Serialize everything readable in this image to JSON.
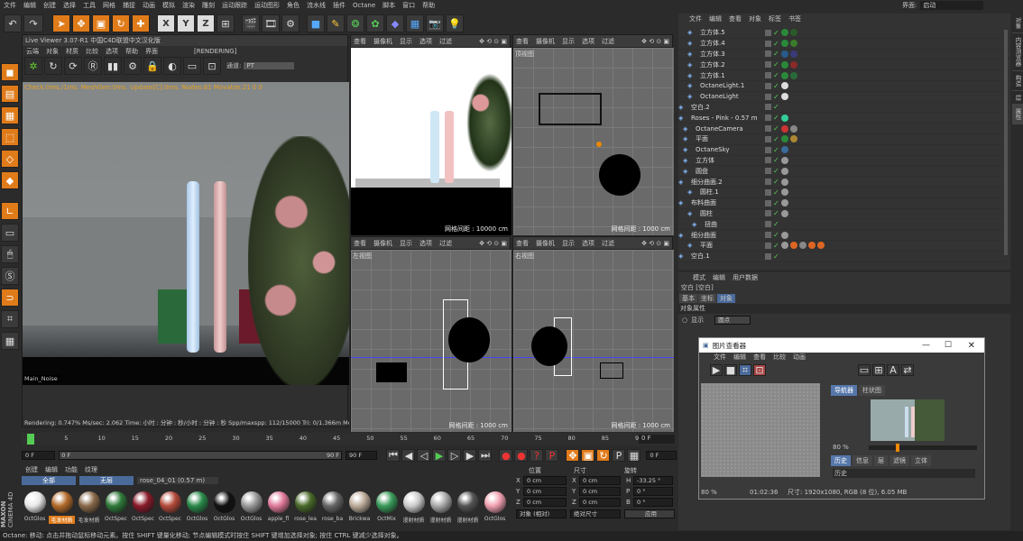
{
  "main_menu": [
    "文件",
    "编辑",
    "创建",
    "选择",
    "工具",
    "网格",
    "捕捉",
    "动画",
    "模拟",
    "渲染",
    "雕刻",
    "运动跟踪",
    "运动图形",
    "角色",
    "流水线",
    "插件",
    "Octane",
    "脚本",
    "窗口",
    "帮助"
  ],
  "layout": {
    "label": "界面:",
    "value": "启动"
  },
  "live_viewer": {
    "title": "Live Viewer 3.07-R1 中国C4D联盟中文汉化版",
    "menu": [
      "云端",
      "对象",
      "材质",
      "比较",
      "选项",
      "帮助",
      "界面"
    ],
    "status_tag": "[RENDERING]",
    "channel_label": "通道:",
    "channel_value": "PT",
    "check_line": "Check:0ms./1ms. MeshGen:0ms. Update[C]:0ms. Nodes:81 Movable:21 0 0",
    "noise_label": "Main_Noise",
    "bottom_status": "Rendering: 0.747% Ms/sec: 2.062    Time: 小时 : 分钟 : 秒/小时 : 分钟 : 秒    Spp/maxspp: 112/15000  Tri: 0/1.366m  Mesh: 23  Hai"
  },
  "viewport_menu": [
    "查看",
    "摄像机",
    "显示",
    "选项",
    "过滤"
  ],
  "viewports": [
    {
      "name": "",
      "grid": ""
    },
    {
      "name": "顶视图",
      "grid": "网格间距 : 1000 cm"
    },
    {
      "name": "左视图",
      "grid": "网格间距 : 1000 cm"
    },
    {
      "name": "右视图",
      "grid": "网格间距 : 1000 cm"
    }
  ],
  "camera_view_grid": "网格间距 : 10000 cm",
  "timeline": {
    "ticks": [
      "0",
      "5",
      "10",
      "15",
      "20",
      "25",
      "30",
      "35",
      "40",
      "45",
      "50",
      "55",
      "60",
      "65",
      "70",
      "75",
      "80",
      "85",
      "90"
    ],
    "current": "0 F",
    "start": "0 F",
    "range_start": "0 F",
    "range_end": "90 F",
    "end": "90 F",
    "end2": "0 F"
  },
  "material_manager": {
    "menu": [
      "创建",
      "编辑",
      "功能",
      "纹理"
    ],
    "filters": [
      "全部",
      "无层",
      "rose_04_01 (0.57 m)"
    ],
    "materials": [
      {
        "name": "OctGlos",
        "color": "#e8e8e8"
      },
      {
        "name": "毛发材质",
        "color": "#b36b2a",
        "selected": true
      },
      {
        "name": "毛发材质",
        "color": "#8a6a4a"
      },
      {
        "name": "OctSpec",
        "color": "#2f7a3a"
      },
      {
        "name": "OctSpec",
        "color": "#8a1a2a"
      },
      {
        "name": "OctSpec",
        "color": "#b34a3a"
      },
      {
        "name": "OctGlos",
        "color": "#2a8a4a"
      },
      {
        "name": "OctGlos",
        "color": "#111111"
      },
      {
        "name": "OctGlos",
        "color": "#999999"
      },
      {
        "name": "apple_fl",
        "color": "#e07a9a"
      },
      {
        "name": "rose_lea",
        "color": "#4a6a2a"
      },
      {
        "name": "rose_ba",
        "color": "#666666"
      },
      {
        "name": "Brickwa",
        "color": "#bbaa99"
      },
      {
        "name": "OctMix",
        "color": "#3a9a5a"
      },
      {
        "name": "漫射材质",
        "color": "#cccccc"
      },
      {
        "name": "漫射材质",
        "color": "#aaaaaa"
      },
      {
        "name": "漫射材质",
        "color": "#555555"
      },
      {
        "name": "OctGlos",
        "color": "#f0a0b0"
      }
    ]
  },
  "coords": {
    "headers": [
      "位置",
      "尺寸",
      "旋转"
    ],
    "rows": [
      {
        "axis": "X",
        "pos": "0 cm",
        "size": "0 cm",
        "rlabel": "H",
        "rot": "-33.25 °"
      },
      {
        "axis": "Y",
        "pos": "0 cm",
        "size": "0 cm",
        "rlabel": "P",
        "rot": "0 °"
      },
      {
        "axis": "Z",
        "pos": "0 cm",
        "size": "0 cm",
        "rlabel": "B",
        "rot": "0 °"
      }
    ],
    "mode": "对象 (相对)",
    "size_mode": "绝对尺寸",
    "apply": "应用"
  },
  "object_manager": {
    "menu": [
      "文件",
      "编辑",
      "查看",
      "对象",
      "标签",
      "书签"
    ],
    "objects": [
      {
        "name": "立方体.5",
        "indent": 2,
        "tags": [
          "#2a8a3a",
          "#2a5a2a"
        ]
      },
      {
        "name": "立方体.4",
        "indent": 2,
        "tags": [
          "#2a8a3a",
          "#3a7a2a"
        ]
      },
      {
        "name": "立方体.3",
        "indent": 2,
        "tags": [
          "#2a5a8a",
          "#3a3a7a"
        ]
      },
      {
        "name": "立方体.2",
        "indent": 2,
        "tags": [
          "#2a8a3a",
          "#8a2a2a"
        ]
      },
      {
        "name": "立方体.1",
        "indent": 2,
        "tags": [
          "#2a8a3a",
          "#2a6a3a"
        ]
      },
      {
        "name": "OctaneLight.1",
        "indent": 2,
        "tags": [
          "#dddddd"
        ]
      },
      {
        "name": "OctaneLight",
        "indent": 2,
        "tags": [
          "#dddddd"
        ]
      },
      {
        "name": "空白.2",
        "indent": 0,
        "tags": []
      },
      {
        "name": "Roses - Pink - 0.57 m",
        "indent": 0,
        "tags": [
          "#3c9"
        ]
      },
      {
        "name": "OctaneCamera",
        "indent": 1,
        "tags": [
          "#cc3333",
          "#888888"
        ]
      },
      {
        "name": "平面",
        "indent": 1,
        "tags": [
          "#2a8a3a",
          "#aa8833"
        ]
      },
      {
        "name": "OctaneSky",
        "indent": 1,
        "tags": [
          "#3a6a9a"
        ]
      },
      {
        "name": "立方体",
        "indent": 1,
        "tags": [
          "#999999"
        ]
      },
      {
        "name": "圆盘",
        "indent": 1,
        "tags": [
          "#999999"
        ]
      },
      {
        "name": "细分曲面.2",
        "indent": 0,
        "tags": [
          "#999999"
        ]
      },
      {
        "name": "圆柱.1",
        "indent": 2,
        "tags": [
          "#999999"
        ]
      },
      {
        "name": "布料曲面",
        "indent": 0,
        "tags": [
          "#999999"
        ]
      },
      {
        "name": "圆柱",
        "indent": 2,
        "tags": [
          "#999999"
        ]
      },
      {
        "name": "扭曲",
        "indent": 3,
        "tags": []
      },
      {
        "name": "细分曲面",
        "indent": 0,
        "tags": [
          "#999999"
        ]
      },
      {
        "name": "平面",
        "indent": 2,
        "tags": [
          "#999999",
          "#dd6622",
          "#888888",
          "#dd6622",
          "#dd6622"
        ]
      },
      {
        "name": "空白.1",
        "indent": 0,
        "tags": []
      }
    ]
  },
  "attributes": {
    "menu": [
      "模式",
      "编辑",
      "用户数据"
    ],
    "title": "空白 [空白]",
    "tabs": [
      "基本",
      "坐标",
      "对象"
    ],
    "section": "对象属性",
    "display_label": "显示",
    "display_value": "圆点"
  },
  "picture_viewer": {
    "title": "图片查看器",
    "menu": [
      "文件",
      "编辑",
      "查看",
      "比较",
      "动画"
    ],
    "tabs": [
      "导航器",
      "柱状图"
    ],
    "zoom": "80 %",
    "zoom2": "80 %",
    "time": "01:02:36",
    "info": "尺寸: 1920x1080, RGB (8 位), 6.05 MB",
    "bottom_tabs": [
      "历史",
      "信息",
      "层",
      "滤镜",
      "立体"
    ],
    "history_label": "历史"
  },
  "status_bar": "Octane:    移动: 点击并拖动鼠标移动元素。按住 SHIFT 键量化移动; 节点编辑模式时按住 SHIFT 键增加选择对象; 按住 CTRL 键减少选择对象。",
  "right_tabs": [
    "对象",
    "内容浏览器",
    "构造",
    "层",
    "属性"
  ],
  "brand": {
    "line1": "MAXON",
    "line2": "CINEMA 4D"
  }
}
